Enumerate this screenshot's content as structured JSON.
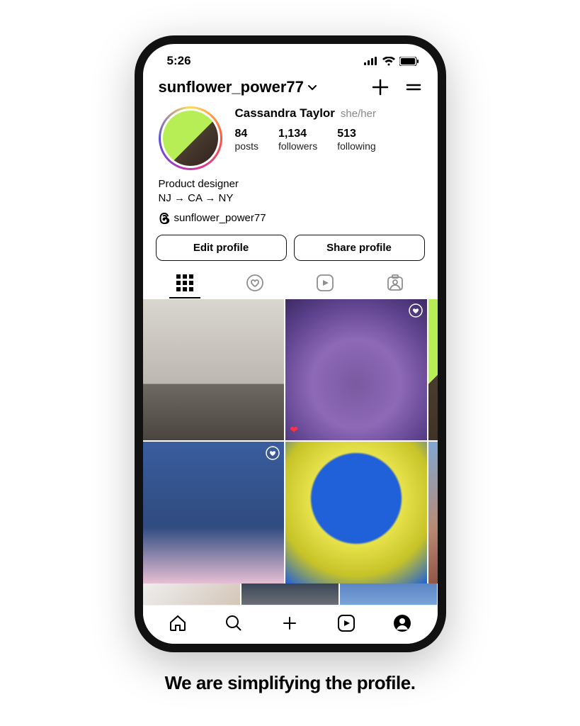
{
  "statusbar": {
    "time": "5:26"
  },
  "header": {
    "username": "sunflower_power77"
  },
  "profile": {
    "display_name": "Cassandra Taylor",
    "pronouns": "she/her",
    "posts_count": "84",
    "posts_label": "posts",
    "followers_count": "1,134",
    "followers_label": "followers",
    "following_count": "513",
    "following_label": "following",
    "bio_line1": "Product designer",
    "bio_line2": "NJ → CA → NY",
    "threads_handle": "sunflower_power77"
  },
  "buttons": {
    "edit": "Edit profile",
    "share": "Share profile"
  },
  "caption": "We are simplifying the profile."
}
